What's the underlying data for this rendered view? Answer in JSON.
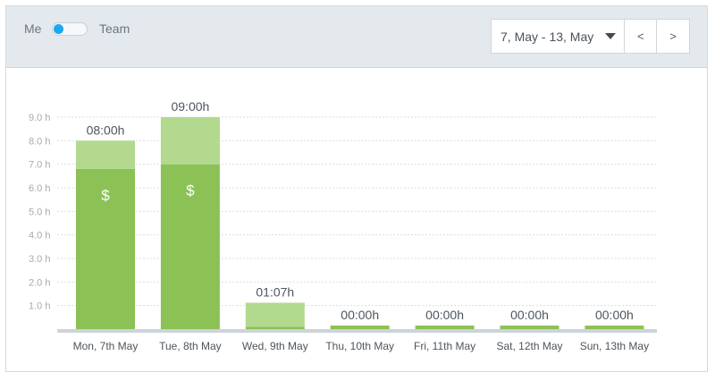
{
  "toggle": {
    "left_label": "Me",
    "right_label": "Team",
    "state": "Me"
  },
  "date_range": {
    "selected": "7, May - 13, May",
    "prev_label": "<",
    "next_label": ">"
  },
  "colors": {
    "billable": "#8bc155",
    "non_billable": "#b2d98e",
    "accent": "#1ba8f0"
  },
  "chart_data": {
    "type": "bar",
    "stacked": true,
    "categories": [
      "Mon, 7th May",
      "Tue, 8th May",
      "Wed, 9th May",
      "Thu, 10th May",
      "Fri, 11th May",
      "Sat, 12th May",
      "Sun, 13th May"
    ],
    "series": [
      {
        "values": [
          6.8,
          7.0,
          0.1,
          0.15,
          0.15,
          0.15,
          0.15
        ],
        "color": "#8bc155"
      },
      {
        "values": [
          1.2,
          2.0,
          1.02,
          0,
          0,
          0,
          0
        ],
        "color": "#b2d98e"
      }
    ],
    "total_labels": [
      "08:00h",
      "09:00h",
      "01:07h",
      "00:00h",
      "00:00h",
      "00:00h",
      "00:00h"
    ],
    "billable_marker": "$",
    "billable_marked": [
      true,
      true,
      false,
      false,
      false,
      false,
      false
    ],
    "yticks": [
      1,
      2,
      3,
      4,
      5,
      6,
      7,
      8,
      9
    ],
    "ytick_labels": [
      "1.0 h",
      "2.0 h",
      "3.0 h",
      "4.0 h",
      "5.0 h",
      "6.0 h",
      "7.0 h",
      "8.0 h",
      "9.0 h"
    ],
    "ylim": [
      0,
      9
    ],
    "grid": true
  }
}
